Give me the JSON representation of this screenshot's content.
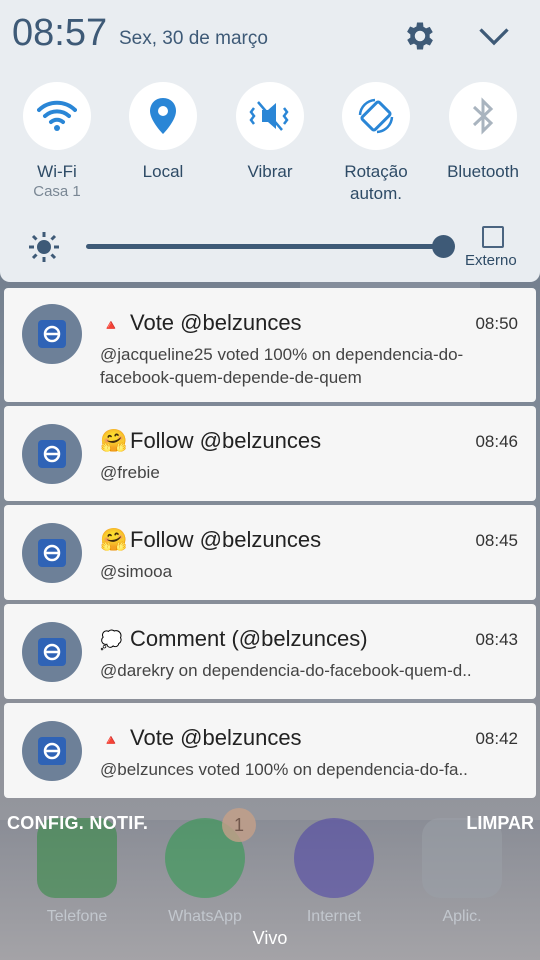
{
  "status": {
    "time": "08:57",
    "date": "Sex, 30 de março"
  },
  "quick_settings": [
    {
      "label": "Wi-Fi",
      "sub": "Casa 1",
      "icon": "wifi-icon",
      "active": true
    },
    {
      "label": "Local",
      "sub": "",
      "icon": "location-icon",
      "active": true
    },
    {
      "label": "Vibrar",
      "sub": "",
      "icon": "vibrate-icon",
      "active": true
    },
    {
      "label": "Rotação\nautom.",
      "sub": "",
      "icon": "rotate-icon",
      "active": true
    },
    {
      "label": "Bluetooth",
      "sub": "",
      "icon": "bluetooth-icon",
      "active": false
    }
  ],
  "brightness": {
    "level": 0.98,
    "external_label": "Externo"
  },
  "notifications": [
    {
      "emoji": "🔺",
      "emoji_icon": "red-triangle-icon",
      "title": "Vote @belzunces",
      "time": "08:50",
      "body": "@jacqueline25 voted 100% on dependencia-do-facebook-quem-depende-de-quem"
    },
    {
      "emoji": "🤗",
      "emoji_icon": "hugging-face-icon",
      "title": "Follow @belzunces",
      "time": "08:46",
      "body": "@frebie"
    },
    {
      "emoji": "🤗",
      "emoji_icon": "hugging-face-icon",
      "title": "Follow @belzunces",
      "time": "08:45",
      "body": "@simooa"
    },
    {
      "emoji": "💭",
      "emoji_icon": "speech-bubble-icon",
      "title": "Comment (@belzunces)",
      "time": "08:43",
      "body": "@darekry on dependencia-do-facebook-quem-d.."
    },
    {
      "emoji": "🔺",
      "emoji_icon": "red-triangle-icon",
      "title": "Vote @belzunces",
      "time": "08:42",
      "body": "@belzunces voted 100% on dependencia-do-fa.."
    }
  ],
  "footer": {
    "settings_label": "CONFIG. NOTIF.",
    "clear_label": "LIMPAR",
    "carrier": "Vivo"
  },
  "apps": [
    {
      "name": "Telefone",
      "color": "#2e8b3e"
    },
    {
      "name": "WhatsApp",
      "color": "#2a9a4a",
      "badge": "1"
    },
    {
      "name": "Internet",
      "color": "#4b3fa8"
    },
    {
      "name": "Aplic.",
      "color": "#9aa0a8"
    }
  ],
  "colors": {
    "accent": "#3e5a77",
    "active_icon": "#2a86d6",
    "inactive_icon": "#a9b4bf"
  }
}
